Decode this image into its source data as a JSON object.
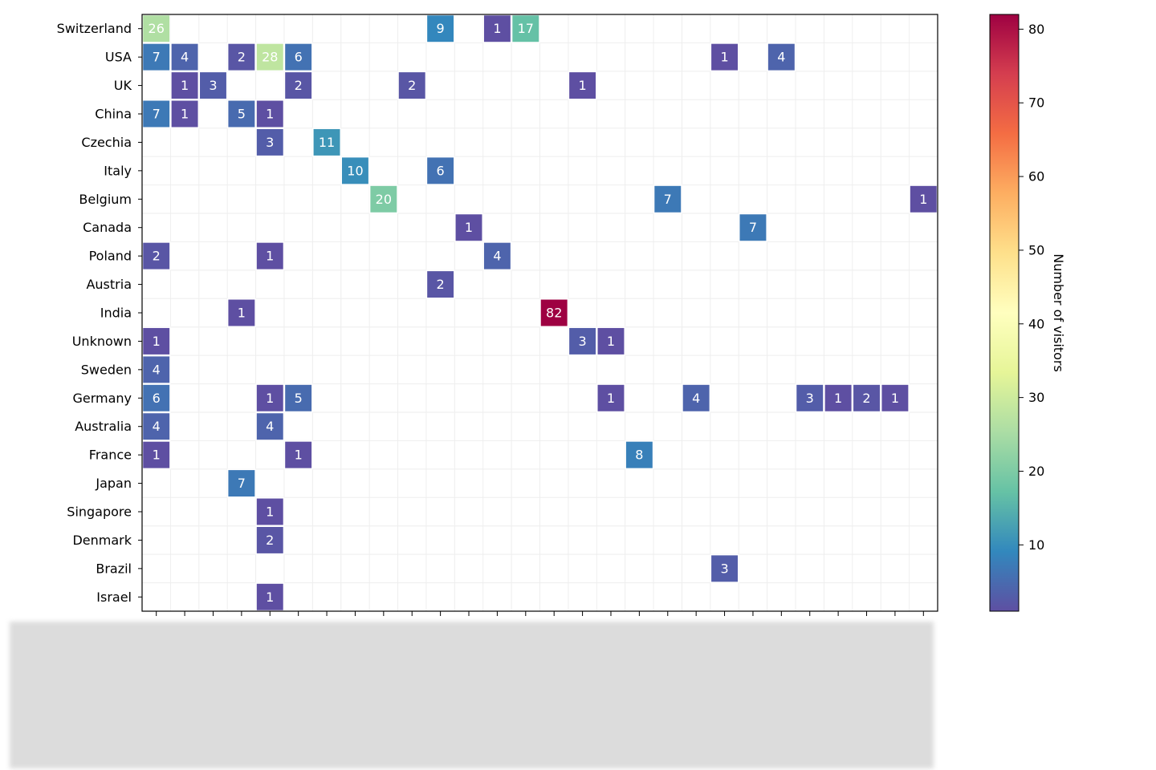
{
  "chart_data": {
    "type": "heatmap",
    "title": "",
    "xlabel": "",
    "ylabel": "",
    "rows": [
      "Switzerland",
      "USA",
      "UK",
      "China",
      "Czechia",
      "Italy",
      "Belgium",
      "Canada",
      "Poland",
      "Austria",
      "India",
      "Unknown",
      "Sweden",
      "Germany",
      "Australia",
      "France",
      "Japan",
      "Singapore",
      "Denmark",
      "Brazil",
      "Israel"
    ],
    "column_count": 28,
    "cells": [
      {
        "row": "Switzerland",
        "col": 0,
        "value": 26
      },
      {
        "row": "Switzerland",
        "col": 10,
        "value": 9
      },
      {
        "row": "Switzerland",
        "col": 12,
        "value": 1
      },
      {
        "row": "Switzerland",
        "col": 13,
        "value": 17
      },
      {
        "row": "USA",
        "col": 0,
        "value": 7
      },
      {
        "row": "USA",
        "col": 1,
        "value": 4
      },
      {
        "row": "USA",
        "col": 3,
        "value": 2
      },
      {
        "row": "USA",
        "col": 4,
        "value": 28
      },
      {
        "row": "USA",
        "col": 5,
        "value": 6
      },
      {
        "row": "USA",
        "col": 20,
        "value": 1
      },
      {
        "row": "USA",
        "col": 22,
        "value": 4
      },
      {
        "row": "UK",
        "col": 1,
        "value": 1
      },
      {
        "row": "UK",
        "col": 2,
        "value": 3
      },
      {
        "row": "UK",
        "col": 5,
        "value": 2
      },
      {
        "row": "UK",
        "col": 9,
        "value": 2
      },
      {
        "row": "UK",
        "col": 15,
        "value": 1
      },
      {
        "row": "China",
        "col": 0,
        "value": 7
      },
      {
        "row": "China",
        "col": 1,
        "value": 1
      },
      {
        "row": "China",
        "col": 3,
        "value": 5
      },
      {
        "row": "China",
        "col": 4,
        "value": 1
      },
      {
        "row": "Czechia",
        "col": 4,
        "value": 3
      },
      {
        "row": "Czechia",
        "col": 6,
        "value": 11
      },
      {
        "row": "Italy",
        "col": 7,
        "value": 10
      },
      {
        "row": "Italy",
        "col": 10,
        "value": 6
      },
      {
        "row": "Belgium",
        "col": 8,
        "value": 20
      },
      {
        "row": "Belgium",
        "col": 18,
        "value": 7
      },
      {
        "row": "Belgium",
        "col": 27,
        "value": 1
      },
      {
        "row": "Canada",
        "col": 11,
        "value": 1
      },
      {
        "row": "Canada",
        "col": 21,
        "value": 7
      },
      {
        "row": "Poland",
        "col": 0,
        "value": 2
      },
      {
        "row": "Poland",
        "col": 4,
        "value": 1
      },
      {
        "row": "Poland",
        "col": 12,
        "value": 4
      },
      {
        "row": "Austria",
        "col": 10,
        "value": 2
      },
      {
        "row": "India",
        "col": 3,
        "value": 1
      },
      {
        "row": "India",
        "col": 14,
        "value": 82
      },
      {
        "row": "Unknown",
        "col": 0,
        "value": 1
      },
      {
        "row": "Unknown",
        "col": 15,
        "value": 3
      },
      {
        "row": "Unknown",
        "col": 16,
        "value": 1
      },
      {
        "row": "Sweden",
        "col": 0,
        "value": 4
      },
      {
        "row": "Germany",
        "col": 0,
        "value": 6
      },
      {
        "row": "Germany",
        "col": 4,
        "value": 1
      },
      {
        "row": "Germany",
        "col": 5,
        "value": 5
      },
      {
        "row": "Germany",
        "col": 16,
        "value": 1
      },
      {
        "row": "Germany",
        "col": 19,
        "value": 4
      },
      {
        "row": "Germany",
        "col": 23,
        "value": 3
      },
      {
        "row": "Germany",
        "col": 24,
        "value": 1
      },
      {
        "row": "Germany",
        "col": 25,
        "value": 2
      },
      {
        "row": "Germany",
        "col": 26,
        "value": 1
      },
      {
        "row": "Australia",
        "col": 0,
        "value": 4
      },
      {
        "row": "Australia",
        "col": 4,
        "value": 4
      },
      {
        "row": "France",
        "col": 0,
        "value": 1
      },
      {
        "row": "France",
        "col": 5,
        "value": 1
      },
      {
        "row": "France",
        "col": 17,
        "value": 8
      },
      {
        "row": "Japan",
        "col": 3,
        "value": 7
      },
      {
        "row": "Singapore",
        "col": 4,
        "value": 1
      },
      {
        "row": "Denmark",
        "col": 4,
        "value": 2
      },
      {
        "row": "Brazil",
        "col": 20,
        "value": 3
      },
      {
        "row": "Israel",
        "col": 4,
        "value": 1
      }
    ],
    "colormap": "Spectral_r",
    "colorbar": {
      "label": "Number of visitors",
      "range": [
        1,
        82
      ],
      "ticks": [
        10,
        20,
        30,
        40,
        50,
        60,
        70,
        80
      ]
    },
    "grid": true,
    "x_tick_labels": "hidden (blurred)"
  }
}
